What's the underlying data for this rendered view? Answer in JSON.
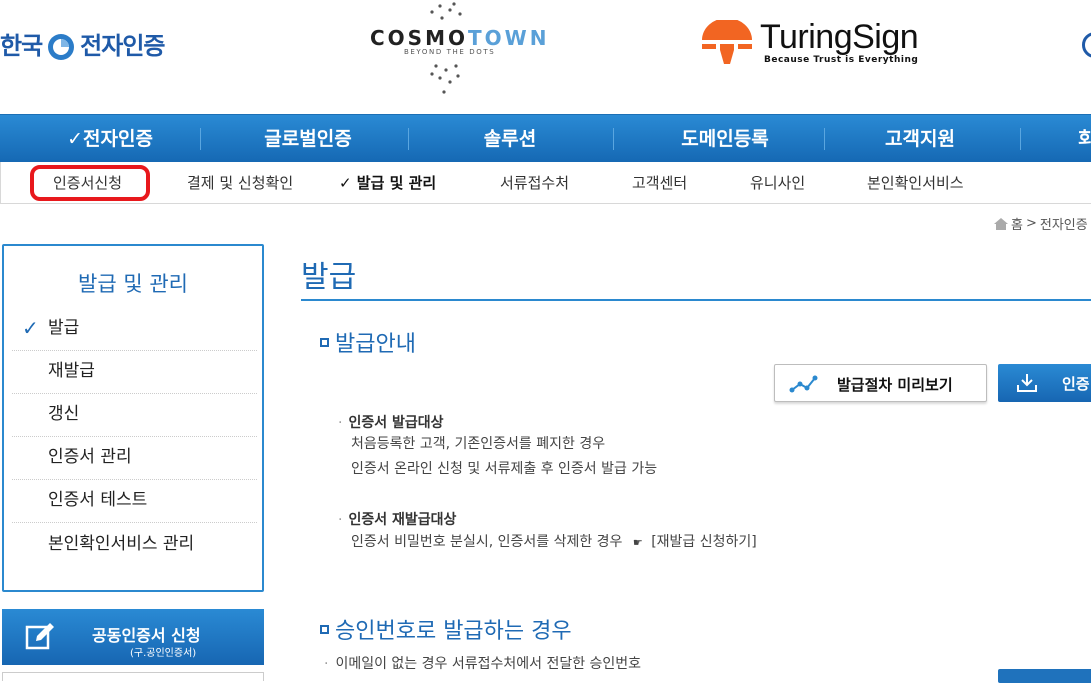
{
  "logos": {
    "korea": "한국 전자인증",
    "cosmotown": {
      "prefix": "COSMO",
      "suffix": "TOWN",
      "tagline": "BEYOND THE DOTS"
    },
    "turingsign": {
      "name": "TuringSign",
      "tagline": "Because Trust is Everything"
    }
  },
  "main_nav": [
    "✓전자인증",
    "글로벌인증",
    "솔루션",
    "도메인등록",
    "고객지원",
    "회"
  ],
  "sub_nav": {
    "items": [
      "인증서신청",
      "결제 및 신청확인",
      "✓ 발급 및 관리",
      "서류접수처",
      "고객센터",
      "유니사인",
      "본인확인서비스"
    ],
    "active_index": 2,
    "highlight_color": "#e8181c"
  },
  "breadcrumb": {
    "home": "홈",
    "separator": ">",
    "current": "전자인증"
  },
  "sidebar": {
    "title": "발급 및 관리",
    "items": [
      {
        "check": "✓",
        "label": "발급"
      },
      {
        "check": "",
        "label": "재발급"
      },
      {
        "check": "",
        "label": "갱신"
      },
      {
        "check": "",
        "label": "인증서 관리"
      },
      {
        "check": "",
        "label": "인증서 테스트"
      },
      {
        "check": "",
        "label": "본인확인서비스 관리"
      }
    ],
    "banner": {
      "label": "공동인증서 신청",
      "sub": "(구.공인인증서)"
    }
  },
  "content": {
    "title": "발급",
    "section1": {
      "title": "발급안내",
      "preview_button": "발급절차 미리보기",
      "download_button": "인증",
      "groups": [
        {
          "head": "인증서 발급대상",
          "lines": [
            "처음등록한 고객, 기존인증서를 폐지한 경우",
            "인증서 온라인 신청 및 서류제출 후 인증서 발급 가능"
          ]
        },
        {
          "head": "인증서 재발급대상",
          "lines": [
            "인증서 비밀번호 분실시, 인증서를 삭제한 경우"
          ],
          "link": "[재발급 신청하기]"
        }
      ]
    },
    "section2": {
      "title": "승인번호로 발급하는 경우",
      "line": "이메일이 없는 경우 서류접수처에서 전달한 승인번호"
    }
  },
  "colors": {
    "primary": "#1f6ab4",
    "nav": "#1a73bd",
    "accent_orange": "#f26522"
  }
}
